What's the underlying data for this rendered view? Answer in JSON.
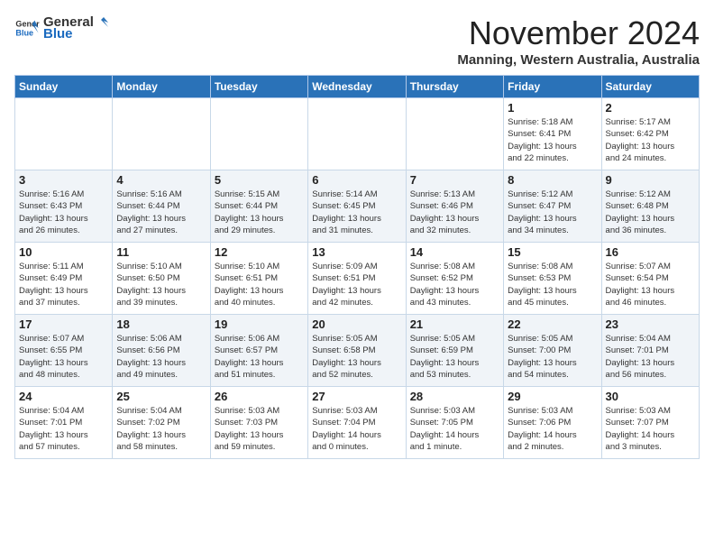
{
  "logo": {
    "general": "General",
    "blue": "Blue"
  },
  "title": "November 2024",
  "location": "Manning, Western Australia, Australia",
  "days_of_week": [
    "Sunday",
    "Monday",
    "Tuesday",
    "Wednesday",
    "Thursday",
    "Friday",
    "Saturday"
  ],
  "weeks": [
    [
      {
        "day": "",
        "info": ""
      },
      {
        "day": "",
        "info": ""
      },
      {
        "day": "",
        "info": ""
      },
      {
        "day": "",
        "info": ""
      },
      {
        "day": "",
        "info": ""
      },
      {
        "day": "1",
        "info": "Sunrise: 5:18 AM\nSunset: 6:41 PM\nDaylight: 13 hours\nand 22 minutes."
      },
      {
        "day": "2",
        "info": "Sunrise: 5:17 AM\nSunset: 6:42 PM\nDaylight: 13 hours\nand 24 minutes."
      }
    ],
    [
      {
        "day": "3",
        "info": "Sunrise: 5:16 AM\nSunset: 6:43 PM\nDaylight: 13 hours\nand 26 minutes."
      },
      {
        "day": "4",
        "info": "Sunrise: 5:16 AM\nSunset: 6:44 PM\nDaylight: 13 hours\nand 27 minutes."
      },
      {
        "day": "5",
        "info": "Sunrise: 5:15 AM\nSunset: 6:44 PM\nDaylight: 13 hours\nand 29 minutes."
      },
      {
        "day": "6",
        "info": "Sunrise: 5:14 AM\nSunset: 6:45 PM\nDaylight: 13 hours\nand 31 minutes."
      },
      {
        "day": "7",
        "info": "Sunrise: 5:13 AM\nSunset: 6:46 PM\nDaylight: 13 hours\nand 32 minutes."
      },
      {
        "day": "8",
        "info": "Sunrise: 5:12 AM\nSunset: 6:47 PM\nDaylight: 13 hours\nand 34 minutes."
      },
      {
        "day": "9",
        "info": "Sunrise: 5:12 AM\nSunset: 6:48 PM\nDaylight: 13 hours\nand 36 minutes."
      }
    ],
    [
      {
        "day": "10",
        "info": "Sunrise: 5:11 AM\nSunset: 6:49 PM\nDaylight: 13 hours\nand 37 minutes."
      },
      {
        "day": "11",
        "info": "Sunrise: 5:10 AM\nSunset: 6:50 PM\nDaylight: 13 hours\nand 39 minutes."
      },
      {
        "day": "12",
        "info": "Sunrise: 5:10 AM\nSunset: 6:51 PM\nDaylight: 13 hours\nand 40 minutes."
      },
      {
        "day": "13",
        "info": "Sunrise: 5:09 AM\nSunset: 6:51 PM\nDaylight: 13 hours\nand 42 minutes."
      },
      {
        "day": "14",
        "info": "Sunrise: 5:08 AM\nSunset: 6:52 PM\nDaylight: 13 hours\nand 43 minutes."
      },
      {
        "day": "15",
        "info": "Sunrise: 5:08 AM\nSunset: 6:53 PM\nDaylight: 13 hours\nand 45 minutes."
      },
      {
        "day": "16",
        "info": "Sunrise: 5:07 AM\nSunset: 6:54 PM\nDaylight: 13 hours\nand 46 minutes."
      }
    ],
    [
      {
        "day": "17",
        "info": "Sunrise: 5:07 AM\nSunset: 6:55 PM\nDaylight: 13 hours\nand 48 minutes."
      },
      {
        "day": "18",
        "info": "Sunrise: 5:06 AM\nSunset: 6:56 PM\nDaylight: 13 hours\nand 49 minutes."
      },
      {
        "day": "19",
        "info": "Sunrise: 5:06 AM\nSunset: 6:57 PM\nDaylight: 13 hours\nand 51 minutes."
      },
      {
        "day": "20",
        "info": "Sunrise: 5:05 AM\nSunset: 6:58 PM\nDaylight: 13 hours\nand 52 minutes."
      },
      {
        "day": "21",
        "info": "Sunrise: 5:05 AM\nSunset: 6:59 PM\nDaylight: 13 hours\nand 53 minutes."
      },
      {
        "day": "22",
        "info": "Sunrise: 5:05 AM\nSunset: 7:00 PM\nDaylight: 13 hours\nand 54 minutes."
      },
      {
        "day": "23",
        "info": "Sunrise: 5:04 AM\nSunset: 7:01 PM\nDaylight: 13 hours\nand 56 minutes."
      }
    ],
    [
      {
        "day": "24",
        "info": "Sunrise: 5:04 AM\nSunset: 7:01 PM\nDaylight: 13 hours\nand 57 minutes."
      },
      {
        "day": "25",
        "info": "Sunrise: 5:04 AM\nSunset: 7:02 PM\nDaylight: 13 hours\nand 58 minutes."
      },
      {
        "day": "26",
        "info": "Sunrise: 5:03 AM\nSunset: 7:03 PM\nDaylight: 13 hours\nand 59 minutes."
      },
      {
        "day": "27",
        "info": "Sunrise: 5:03 AM\nSunset: 7:04 PM\nDaylight: 14 hours\nand 0 minutes."
      },
      {
        "day": "28",
        "info": "Sunrise: 5:03 AM\nSunset: 7:05 PM\nDaylight: 14 hours\nand 1 minute."
      },
      {
        "day": "29",
        "info": "Sunrise: 5:03 AM\nSunset: 7:06 PM\nDaylight: 14 hours\nand 2 minutes."
      },
      {
        "day": "30",
        "info": "Sunrise: 5:03 AM\nSunset: 7:07 PM\nDaylight: 14 hours\nand 3 minutes."
      }
    ]
  ]
}
